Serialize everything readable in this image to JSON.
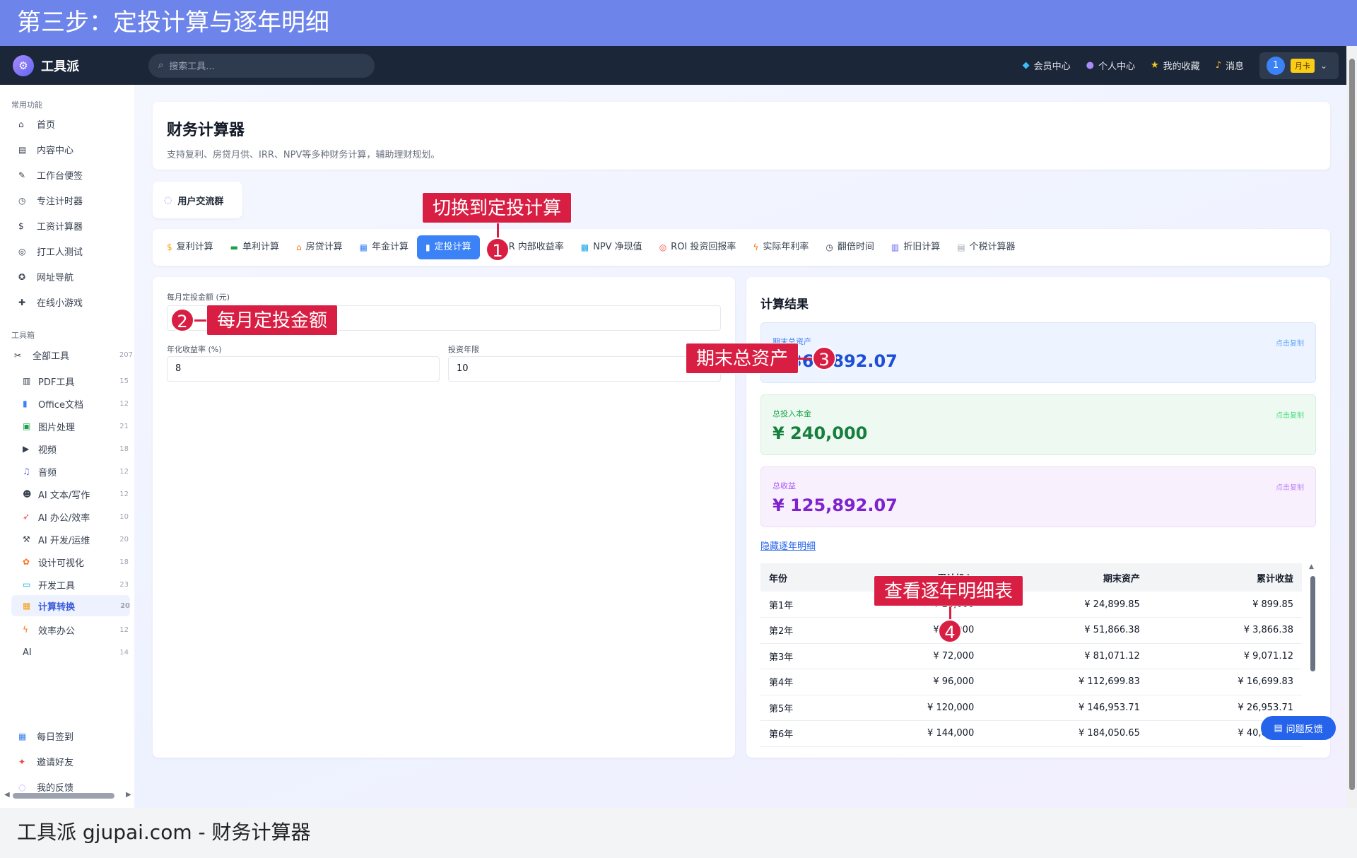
{
  "banner": {
    "title": "第三步：定投计算与逐年明细"
  },
  "footer_caption": "工具派 gjupai.com - 财务计算器",
  "navbar": {
    "logo_text": "工具派",
    "search_placeholder": "搜索工具...",
    "links": [
      {
        "label": "会员中心",
        "icon": "diamond-icon"
      },
      {
        "label": "个人中心",
        "icon": "person-icon"
      },
      {
        "label": "我的收藏",
        "icon": "star-icon"
      },
      {
        "label": "消息",
        "icon": "bell-icon"
      }
    ],
    "user_avatar": "1",
    "vip_tag": "月卡"
  },
  "sidebar": {
    "section_common": "常用功能",
    "common_items": [
      {
        "label": "首页",
        "icon": "home-icon"
      },
      {
        "label": "内容中心",
        "icon": "news-icon"
      },
      {
        "label": "工作台便签",
        "icon": "memo-icon"
      },
      {
        "label": "专注计时器",
        "icon": "stopwatch-icon"
      },
      {
        "label": "工资计算器",
        "icon": "money-bag-icon"
      },
      {
        "label": "打工人测试",
        "icon": "target-icon"
      },
      {
        "label": "网址导航",
        "icon": "compass-icon"
      },
      {
        "label": "在线小游戏",
        "icon": "gamepad-icon"
      }
    ],
    "section_tools": "工具箱",
    "all_tools": {
      "label": "全部工具",
      "count": "207"
    },
    "tool_items": [
      {
        "label": "PDF工具",
        "count": "15",
        "icon": "pdf-icon"
      },
      {
        "label": "Office文档",
        "count": "12",
        "icon": "doc-icon"
      },
      {
        "label": "图片处理",
        "count": "21",
        "icon": "image-icon"
      },
      {
        "label": "视频",
        "count": "18",
        "icon": "video-icon"
      },
      {
        "label": "音频",
        "count": "12",
        "icon": "music-icon"
      },
      {
        "label": "AI 文本/写作",
        "count": "12",
        "icon": "robot-icon"
      },
      {
        "label": "AI 办公/效率",
        "count": "10",
        "icon": "rocket-icon"
      },
      {
        "label": "AI 开发/运维",
        "count": "20",
        "icon": "wrench-icon"
      },
      {
        "label": "设计可视化",
        "count": "18",
        "icon": "palette-icon"
      },
      {
        "label": "开发工具",
        "count": "23",
        "icon": "laptop-icon"
      },
      {
        "label": "计算转换",
        "count": "20",
        "icon": "calculator-icon",
        "active": true
      },
      {
        "label": "效率办公",
        "count": "12",
        "icon": "lightning-icon"
      },
      {
        "label": "AI",
        "count": "14",
        "icon": ""
      }
    ],
    "bottom_items": [
      {
        "label": "每日签到",
        "icon": "calendar-icon"
      },
      {
        "label": "邀请好友",
        "icon": "gift-icon"
      },
      {
        "label": "我的反馈",
        "icon": "chat-icon"
      }
    ]
  },
  "header": {
    "title": "财务计算器",
    "subtitle": "支持复利、房贷月供、IRR、NPV等多种财务计算，辅助理财规划。"
  },
  "community_button": "用户交流群",
  "tabs": [
    {
      "label": "复利计算",
      "icon": "money-bag-icon"
    },
    {
      "label": "单利计算",
      "icon": "cash-icon"
    },
    {
      "label": "房贷计算",
      "icon": "house-icon"
    },
    {
      "label": "年金计算",
      "icon": "calendar-icon"
    },
    {
      "label": "定投计算",
      "icon": "bar-chart-icon",
      "active": true
    },
    {
      "label": "IRR 内部收益率",
      "icon": "trend-icon"
    },
    {
      "label": "NPV 净现值",
      "icon": "map-icon"
    },
    {
      "label": "ROI 投资回报率",
      "icon": "target-icon"
    },
    {
      "label": "实际年利率",
      "icon": "lightning-icon"
    },
    {
      "label": "翻倍时间",
      "icon": "stopwatch-icon"
    },
    {
      "label": "折旧计算",
      "icon": "chart-icon"
    },
    {
      "label": "个税计算器",
      "icon": "receipt-icon"
    }
  ],
  "form": {
    "monthly_label": "每月定投金额 (元)",
    "monthly_value": "",
    "rate_label": "年化收益率 (%)",
    "rate_value": "8",
    "years_label": "投资年限",
    "years_value": "10"
  },
  "results": {
    "title": "计算结果",
    "final_label": "期末总资产",
    "final_value": "¥ 365,892.07",
    "principal_label": "总投入本金",
    "principal_value": "¥ 240,000",
    "gain_label": "总收益",
    "gain_value": "¥ 125,892.07",
    "copy_hint": "点击复制",
    "toggle_link": "隐藏逐年明细",
    "colors": {
      "final": "#1d4ed8",
      "principal": "#15803d",
      "gain": "#7e22ce"
    }
  },
  "table": {
    "headers": [
      "年份",
      "累计投入",
      "期末资产",
      "累计收益"
    ],
    "rows": [
      [
        "第1年",
        "¥ 24,000",
        "¥ 24,899.85",
        "¥ 899.85"
      ],
      [
        "第2年",
        "¥ 48,000",
        "¥ 51,866.38",
        "¥ 3,866.38"
      ],
      [
        "第3年",
        "¥ 72,000",
        "¥ 81,071.12",
        "¥ 9,071.12"
      ],
      [
        "第4年",
        "¥ 96,000",
        "¥ 112,699.83",
        "¥ 16,699.83"
      ],
      [
        "第5年",
        "¥ 120,000",
        "¥ 146,953.71",
        "¥ 26,953.71"
      ],
      [
        "第6年",
        "¥ 144,000",
        "¥ 184,050.65",
        "¥ 40,050.65"
      ]
    ]
  },
  "feedback_button": "问题反馈",
  "callouts": {
    "c1": "切换到定投计算",
    "m1": "1",
    "c2": "每月定投金额",
    "m2": "2",
    "c3": "期末总资产",
    "m3": "3",
    "c4": "查看逐年明细表",
    "m4": "4"
  }
}
